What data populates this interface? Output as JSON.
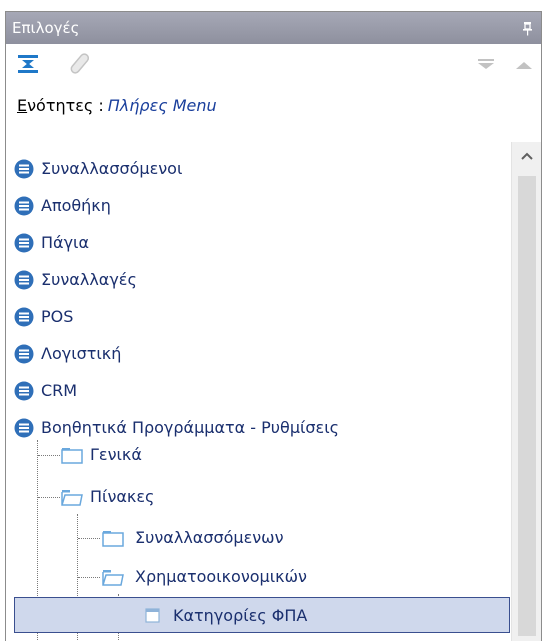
{
  "panel": {
    "title": "Επιλογές"
  },
  "toolbar": {
    "collapse_icon": "collapse-all-icon",
    "clip_icon": "paperclip-icon",
    "down_icon": "arrow-down-icon",
    "up_icon": "arrow-up-icon"
  },
  "section": {
    "label_first_letter": "Ε",
    "label_rest": "νότητες :",
    "value": "Πλήρες Menu"
  },
  "tree": {
    "categories": [
      {
        "label": "Συναλλασσόμενοι"
      },
      {
        "label": "Αποθήκη"
      },
      {
        "label": "Πάγια"
      },
      {
        "label": "Συναλλαγές"
      },
      {
        "label": "POS"
      },
      {
        "label": "Λογιστική"
      },
      {
        "label": "CRM"
      },
      {
        "label": "Βοηθητικά Προγράμματα - Ρυθμίσεις"
      }
    ],
    "folders": [
      {
        "label": "Γενικά"
      },
      {
        "label": "Πίνακες"
      },
      {
        "label": "Συναλλασσόμενων"
      },
      {
        "label": "Χρηματοοικονομικών"
      }
    ],
    "selected_item": {
      "label": "Κατηγορίες ΦΠΑ"
    }
  },
  "colors": {
    "title_bar": "#9a9caa",
    "category_icon": "#2f6fb8",
    "folder_icon": "#6aa8dd",
    "text": "#1a2f6e",
    "selection": "#cfd8ec"
  }
}
